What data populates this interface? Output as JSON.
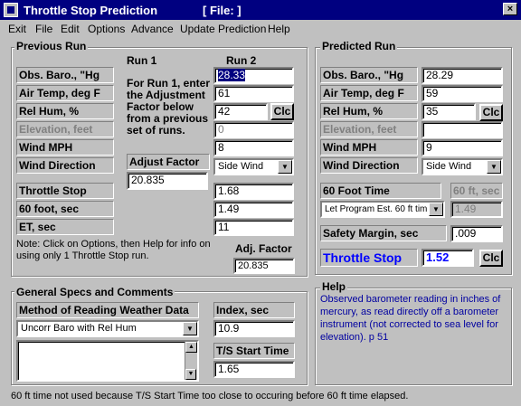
{
  "window": {
    "title": "Throttle Stop Prediction",
    "file_label": "[ File:  ]",
    "close": "×"
  },
  "menu": [
    "Exit",
    "File",
    "Edit",
    "Options",
    "Advance",
    "Update Prediction",
    "Help"
  ],
  "previous_run": {
    "group_title": "Previous Run",
    "run1_header": "Run 1",
    "run2_header": "Run 2",
    "run1_instructions": "For Run 1, enter the Adjustment Factor below from a previous set of runs.",
    "labels": {
      "baro": "Obs. Baro., \"Hg",
      "air_temp": "Air Temp, deg F",
      "rel_hum": "Rel Hum, %",
      "elevation": "Elevation, feet",
      "wind_mph": "Wind MPH",
      "wind_dir": "Wind Direction",
      "throttle_stop": "Throttle Stop",
      "sixty_foot": "60 foot, sec",
      "et": "ET, sec"
    },
    "adjust_factor_label": "Adjust Factor",
    "adjust_factor_value": "20.835",
    "run2": {
      "baro": "28.33",
      "air_temp": "61",
      "rel_hum": "42",
      "elevation": "0",
      "wind_mph": "8",
      "wind_dir": "Side Wind",
      "throttle_stop": "1.68",
      "sixty_foot": "1.49",
      "et": "11"
    },
    "clc": "Clc",
    "note": "Note:  Click on Options, then Help for info on using only 1 Throttle Stop run.",
    "adj_factor_label": "Adj. Factor",
    "adj_factor_value": "20.835"
  },
  "predicted_run": {
    "group_title": "Predicted Run",
    "labels": {
      "baro": "Obs. Baro., \"Hg",
      "air_temp": "Air Temp, deg F",
      "rel_hum": "Rel Hum, %",
      "elevation": "Elevation, feet",
      "wind_mph": "Wind MPH",
      "wind_dir": "Wind Direction",
      "sixty_foot_time": "60 Foot Time",
      "sixty_ft_sec": "60 ft, sec",
      "safety_margin": "Safety Margin, sec",
      "throttle_stop": "Throttle Stop"
    },
    "values": {
      "baro": "28.29",
      "air_temp": "59",
      "rel_hum": "35",
      "elevation": "",
      "wind_mph": "9",
      "wind_dir": "Side Wind",
      "sixty_mode": "Let Program Est. 60 ft tim",
      "sixty_ft_sec": "1.49",
      "safety_margin": ".009",
      "throttle_stop": "1.52"
    },
    "clc": "Clc"
  },
  "general": {
    "group_title": "General Specs and Comments",
    "method_label": "Method of Reading Weather Data",
    "method_value": "Uncorr Baro with Rel Hum",
    "index_label": "Index, sec",
    "index_value": "10.9",
    "ts_start_label": "T/S Start Time",
    "ts_start_value": "1.65",
    "comments": ""
  },
  "help": {
    "title": "Help",
    "text": "Observed barometer reading in inches of mercury, as read directly off a barometer instrument (not corrected to sea level for elevation).   p 51"
  },
  "status": "60 ft time not used because T/S Start Time too close to occuring before 60 ft time elapsed.",
  "colors": {
    "title_bg": "#000080",
    "face": "#c0c0c0",
    "help_text": "#0000a0",
    "throttle_label": "#0000ff"
  }
}
